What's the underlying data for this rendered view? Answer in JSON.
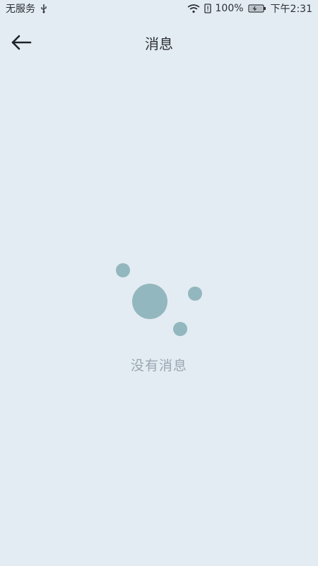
{
  "status_bar": {
    "carrier": "无服务",
    "battery_percent": "100%",
    "time": "下午2:31",
    "icons": [
      "usb-icon",
      "wifi-icon",
      "battery-alert-icon",
      "battery-icon"
    ]
  },
  "header": {
    "title": "消息",
    "back_icon": "arrow-left-icon"
  },
  "empty_state": {
    "message": "没有消息",
    "illustration": "bubbles-illustration"
  },
  "colors": {
    "background": "#e3ecf2",
    "bubble": "#93b7bf",
    "empty_text": "#9aa6b0"
  }
}
